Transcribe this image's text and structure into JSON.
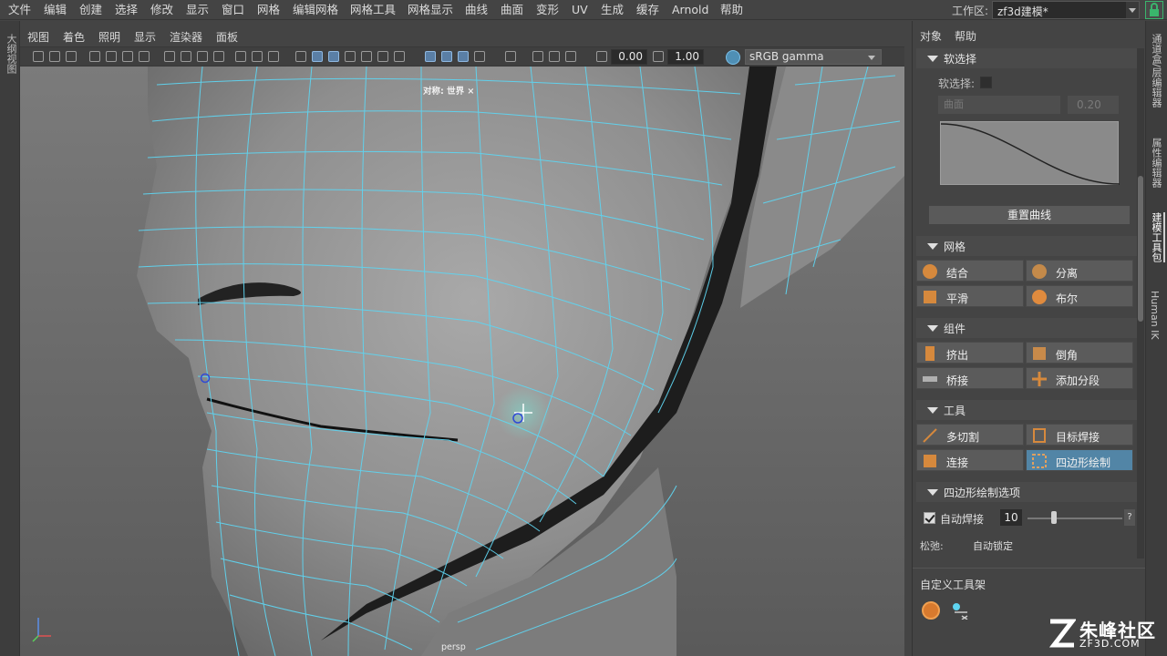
{
  "menubar": {
    "items": [
      "文件",
      "编辑",
      "创建",
      "选择",
      "修改",
      "显示",
      "窗口",
      "网格",
      "编辑网格",
      "网格工具",
      "网格显示",
      "曲线",
      "曲面",
      "变形",
      "UV",
      "生成",
      "缓存",
      "Arnold",
      "帮助"
    ],
    "workspace_label": "工作区:",
    "workspace_value": "zf3d建模*"
  },
  "left_strip": {
    "label": "大纲视图"
  },
  "panel_menu": {
    "items": [
      "视图",
      "着色",
      "照明",
      "显示",
      "渲染器",
      "面板"
    ]
  },
  "viewport_toolbar": {
    "gamma_value": "0.00",
    "exposure_value": "1.00",
    "color_space": "sRGB gamma"
  },
  "viewport": {
    "symmetry_label": "对称: 世界 ×",
    "camera_label": "persp"
  },
  "right_panel": {
    "menus": [
      "对象",
      "帮助"
    ],
    "soft_select": {
      "title": "软选择",
      "label": "软选择:",
      "mode": "曲面",
      "radius": "0.20",
      "reset_curve": "重置曲线"
    },
    "mesh": {
      "title": "网格",
      "buttons": [
        "结合",
        "分离",
        "平滑",
        "布尔"
      ]
    },
    "components": {
      "title": "组件",
      "buttons": [
        "挤出",
        "倒角",
        "桥接",
        "添加分段"
      ]
    },
    "tools": {
      "title": "工具",
      "buttons": [
        "多切割",
        "目标焊接",
        "连接",
        "四边形绘制"
      ]
    },
    "quad_draw_options": {
      "title": "四边形绘制选项",
      "auto_weld_label": "自动焊接",
      "auto_weld_checked": true,
      "weld_value": "10",
      "help": "?",
      "relax_label": "松弛:",
      "relax_mode": "自动锁定"
    },
    "custom_shelf": "自定义工具架"
  },
  "right_tabs": [
    "通道盒/层编辑器",
    "属性编辑器",
    "建模工具包",
    "Human IK"
  ],
  "watermark": {
    "name": "朱峰社区",
    "url": "ZF3D.COM"
  },
  "colors": {
    "wire": "#5fd4f0",
    "selected_button": "#5285a6",
    "lock_accent": "#3ab56c"
  }
}
